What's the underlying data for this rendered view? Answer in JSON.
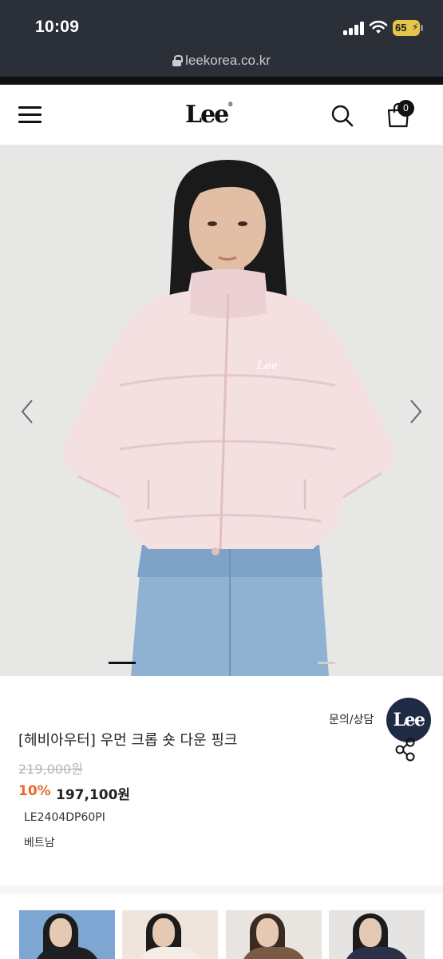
{
  "status_bar": {
    "time": "10:09",
    "battery": "65",
    "url": "leekorea.co.kr"
  },
  "header": {
    "logo": "Lee",
    "logo_mark": "®",
    "cart_count": "0"
  },
  "hero": {
    "slide_count_visible": 1
  },
  "product": {
    "inquiry_label": "문의/상담",
    "brand_badge": "Lee",
    "name": "[헤비아우터] 우먼 크롭 숏 다운 핑크",
    "original_price": "219,000원",
    "discount_rate": "10%",
    "sale_price": "197,100원",
    "sku": "LE2404DP60PI",
    "origin": "베트남"
  },
  "icons": {
    "menu": "hamburger-menu-icon",
    "search": "search-icon",
    "cart": "shopping-bag-icon",
    "share": "share-icon",
    "prev": "chevron-left-icon",
    "next": "chevron-right-icon"
  },
  "colors": {
    "status_bar_bg": "#2b2f37",
    "discount": "#e86a23",
    "brand_badge_bg": "#1f2a44",
    "battery": "#e5c54a"
  }
}
